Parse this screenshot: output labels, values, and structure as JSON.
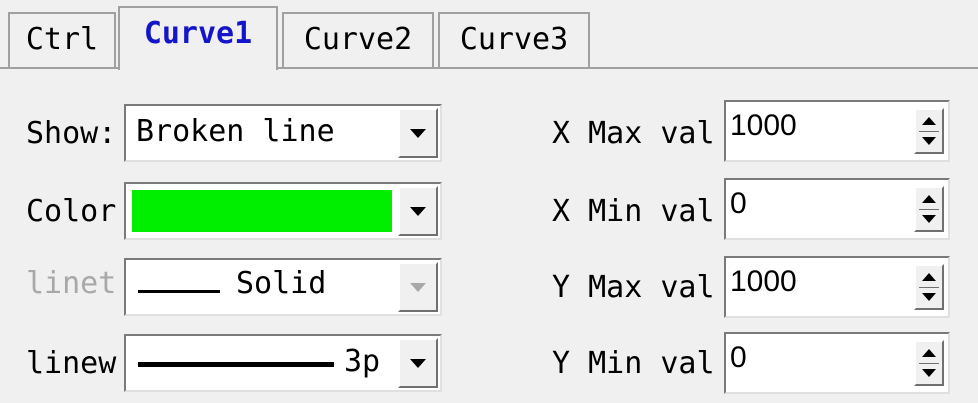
{
  "tabs": [
    {
      "label": "Ctrl"
    },
    {
      "label": "Curve1",
      "active": true
    },
    {
      "label": "Curve2"
    },
    {
      "label": "Curve3"
    }
  ],
  "left": {
    "show_label": "Show:",
    "show_value": "Broken line",
    "color_label": "Color",
    "color_value": "#00ee00",
    "linetype_label": "linet",
    "linetype_value": "Solid",
    "linewidth_label": "linew",
    "linewidth_value": "3p"
  },
  "right": {
    "xmax_label": "X Max val",
    "xmax_value": "1000",
    "xmin_label": "X Min val",
    "xmin_value": "0",
    "ymax_label": "Y Max val",
    "ymax_value": "1000",
    "ymin_label": "Y Min val",
    "ymin_value": "0"
  },
  "icons": {
    "dropdown": "chevron-down-icon",
    "spinner": "spin-up-down-icon"
  },
  "colors": {
    "active_tab_text": "#1414c8",
    "disabled_text": "#a8a8a8",
    "background": "#f0f0f0"
  }
}
